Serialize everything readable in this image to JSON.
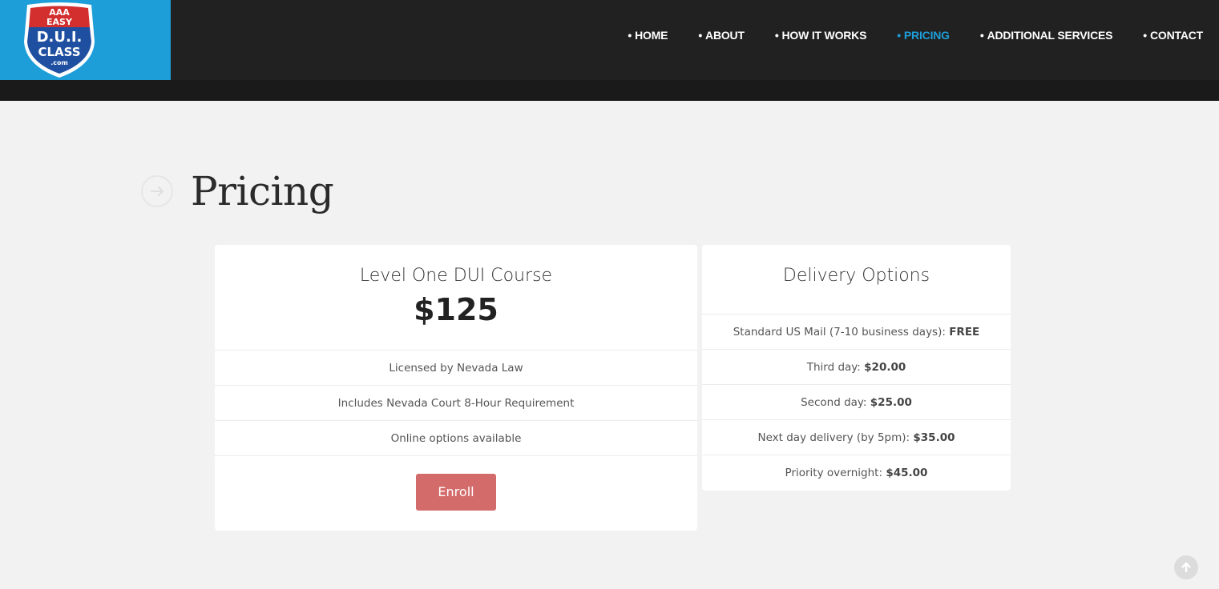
{
  "logo": {
    "line1": "AAA",
    "line2": "EASY",
    "line3": "D.U.I.",
    "line4": "CLASS",
    "line5": ".com"
  },
  "nav": {
    "items": [
      {
        "label": "HOME",
        "active": false
      },
      {
        "label": "ABOUT",
        "active": false
      },
      {
        "label": "HOW IT WORKS",
        "active": false
      },
      {
        "label": "PRICING",
        "active": true
      },
      {
        "label": "ADDITIONAL SERVICES",
        "active": false
      },
      {
        "label": "CONTACT",
        "active": false
      }
    ],
    "bullet": "•"
  },
  "page": {
    "title": "Pricing"
  },
  "course": {
    "title": "Level One DUI Course",
    "price": "$125",
    "features": [
      "Licensed by Nevada Law",
      "Includes Nevada Court 8-Hour Requirement",
      "Online options available"
    ],
    "enroll_label": "Enroll"
  },
  "delivery": {
    "title": "Delivery Options",
    "options": [
      {
        "label": "Standard US Mail (7-10 business days):",
        "price": "FREE"
      },
      {
        "label": "Third day:",
        "price": "$20.00"
      },
      {
        "label": "Second day:",
        "price": "$25.00"
      },
      {
        "label": "Next day delivery (by 5pm):",
        "price": "$35.00"
      },
      {
        "label": "Priority overnight:",
        "price": "$45.00"
      }
    ]
  },
  "colors": {
    "accent": "#1e9ed9",
    "header_bg": "#212121",
    "enroll_bg": "#d46b6b",
    "shield_red": "#d32f2f",
    "shield_blue": "#1f4fa0"
  },
  "icons": {
    "title_icon": "arrow-right-circle-icon",
    "scroll_icon": "arrow-up-circle-icon"
  }
}
